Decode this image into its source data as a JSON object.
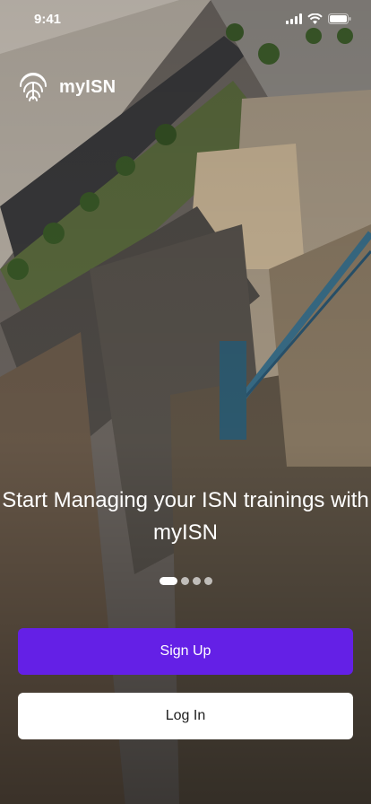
{
  "status_bar": {
    "time": "9:41",
    "icons": [
      "cellular-signal-icon",
      "wifi-icon",
      "battery-icon"
    ]
  },
  "brand": {
    "name": "myISN",
    "icon": "fingerprint-icon"
  },
  "onboarding": {
    "headline": "Start Managing your ISN trainings with myISN",
    "page_count": 4,
    "active_page": 1
  },
  "actions": {
    "signup_label": "Sign Up",
    "login_label": "Log In"
  },
  "colors": {
    "primary": "#6420e6",
    "secondary_button": "#ffffff",
    "text_on_image": "#ffffff"
  }
}
